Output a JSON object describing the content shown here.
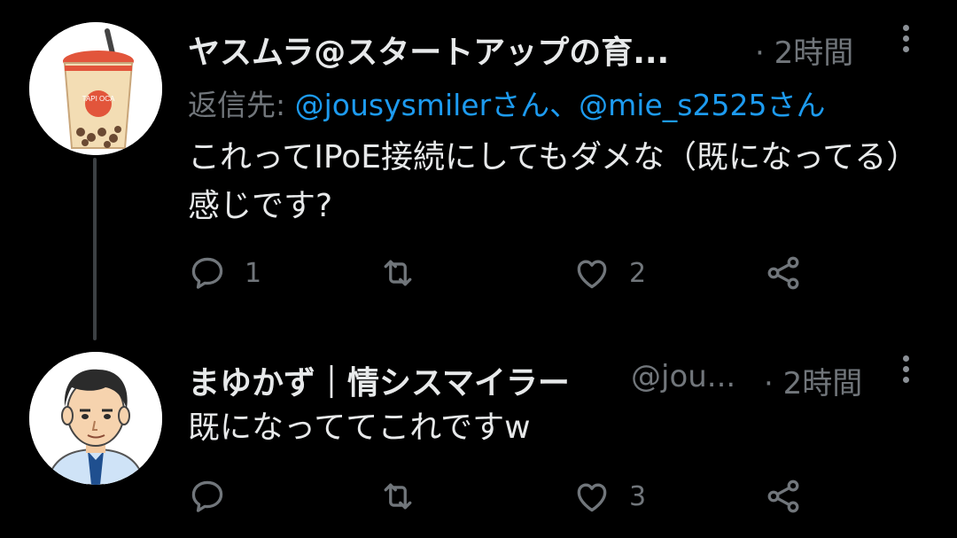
{
  "tweets": [
    {
      "name": "ヤスムラ@スタートアップの育...",
      "time": "· 2時間",
      "reply_label": "返信先: ",
      "reply_mentions": "@jousysmilerさん、@mie_s2525さん",
      "text": "これってIPoE接続にしてもダメな（既になってる）感じです?",
      "reply_count": "1",
      "retweet_count": "",
      "like_count": "2",
      "avatar_badge_text": "TAPI OCA"
    },
    {
      "name": "まゆかず｜情シスマイラー",
      "handle": "@jou...",
      "time": "· 2時間",
      "text": "既になっててこれですw",
      "reply_count": "",
      "retweet_count": "",
      "like_count": "3"
    }
  ],
  "colors": {
    "background": "#000000",
    "text": "#e7e9ea",
    "secondary": "#71767b",
    "link": "#1d9bf0",
    "thread_line": "#3c4043"
  },
  "icons": [
    "reply-icon",
    "retweet-icon",
    "like-icon",
    "share-icon",
    "more-options-icon"
  ]
}
